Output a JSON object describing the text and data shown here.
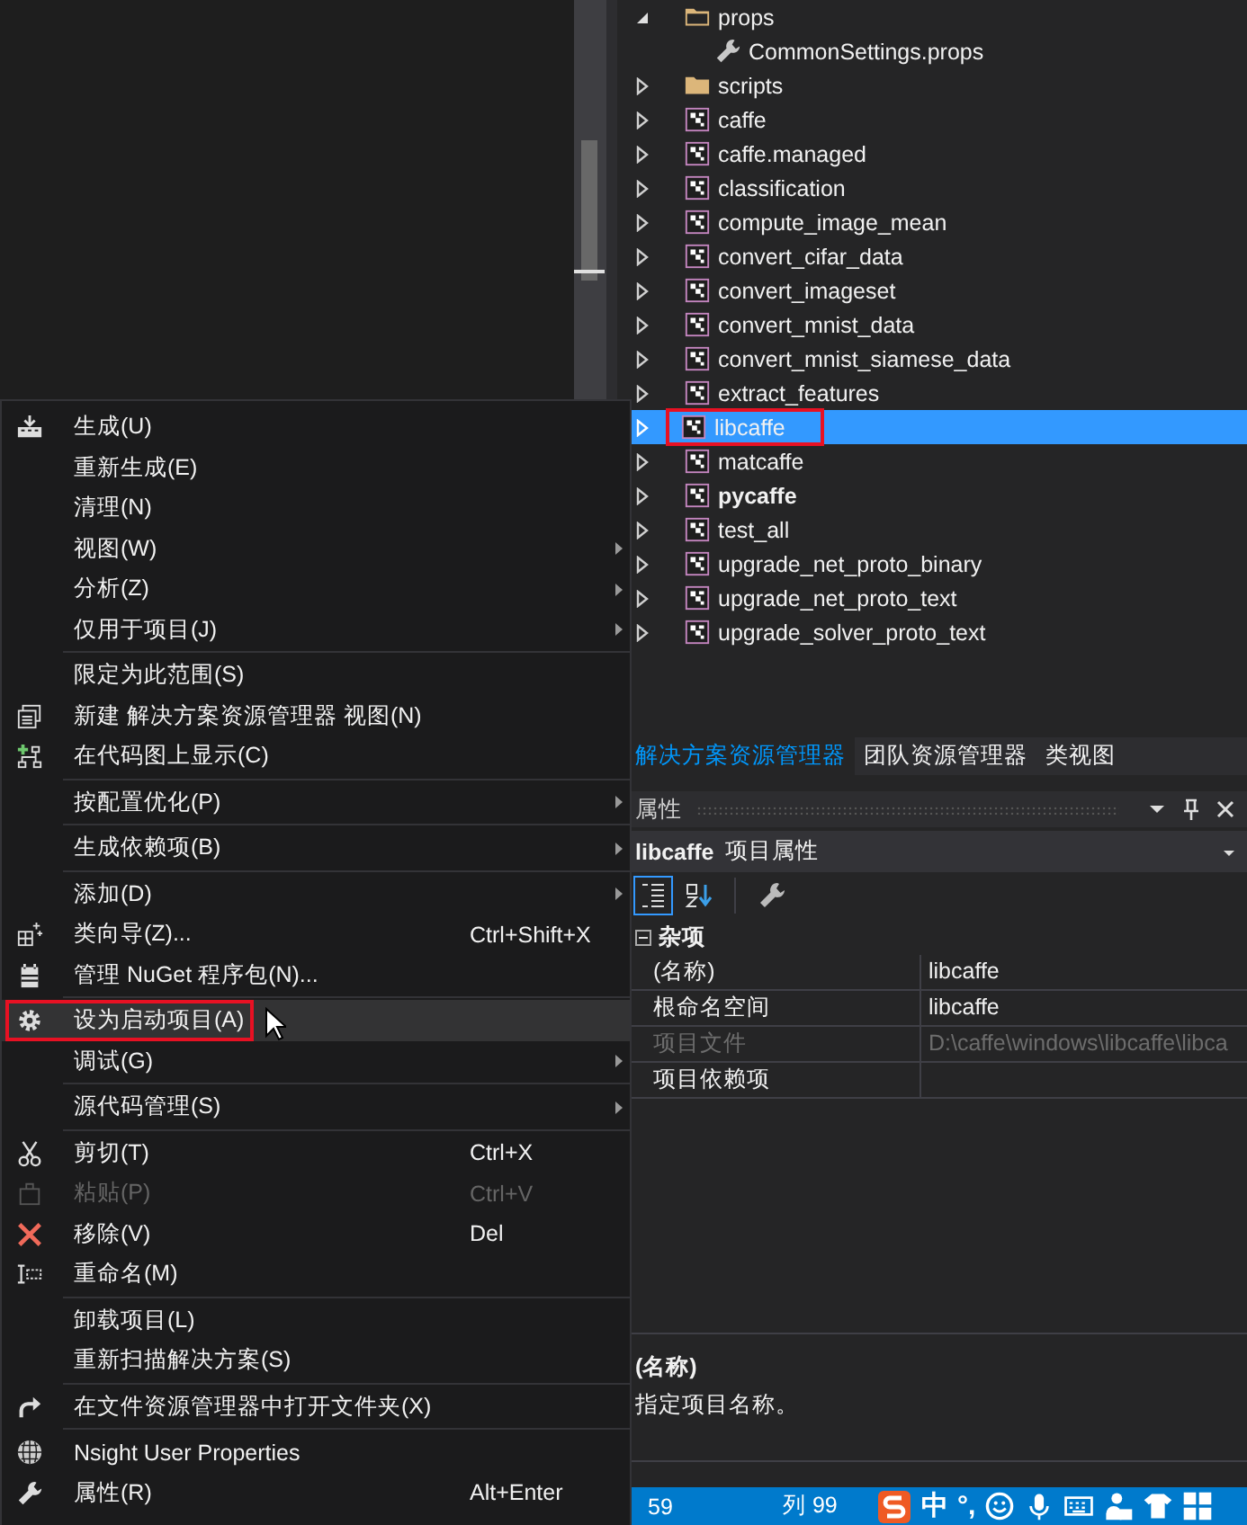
{
  "solution_tree": {
    "items": [
      {
        "label": "props",
        "kind": "folder",
        "expanded": true,
        "bold": false,
        "selected": false,
        "highlighted": false,
        "children": [
          {
            "label": "CommonSettings.props",
            "kind": "settings",
            "bold": false,
            "selected": false,
            "highlighted": false
          }
        ]
      },
      {
        "label": "scripts",
        "kind": "folder",
        "expanded": false,
        "bold": false,
        "selected": false,
        "highlighted": false
      },
      {
        "label": "caffe",
        "kind": "project",
        "expanded": false,
        "bold": false,
        "selected": false,
        "highlighted": false
      },
      {
        "label": "caffe.managed",
        "kind": "project",
        "expanded": false,
        "bold": false,
        "selected": false,
        "highlighted": false
      },
      {
        "label": "classification",
        "kind": "project",
        "expanded": false,
        "bold": false,
        "selected": false,
        "highlighted": false
      },
      {
        "label": "compute_image_mean",
        "kind": "project",
        "expanded": false,
        "bold": false,
        "selected": false,
        "highlighted": false
      },
      {
        "label": "convert_cifar_data",
        "kind": "project",
        "expanded": false,
        "bold": false,
        "selected": false,
        "highlighted": false
      },
      {
        "label": "convert_imageset",
        "kind": "project",
        "expanded": false,
        "bold": false,
        "selected": false,
        "highlighted": false
      },
      {
        "label": "convert_mnist_data",
        "kind": "project",
        "expanded": false,
        "bold": false,
        "selected": false,
        "highlighted": false
      },
      {
        "label": "convert_mnist_siamese_data",
        "kind": "project",
        "expanded": false,
        "bold": false,
        "selected": false,
        "highlighted": false
      },
      {
        "label": "extract_features",
        "kind": "project",
        "expanded": false,
        "bold": false,
        "selected": false,
        "highlighted": false
      },
      {
        "label": "libcaffe",
        "kind": "project",
        "expanded": false,
        "bold": false,
        "selected": true,
        "highlighted": true
      },
      {
        "label": "matcaffe",
        "kind": "project",
        "expanded": false,
        "bold": false,
        "selected": false,
        "highlighted": false
      },
      {
        "label": "pycaffe",
        "kind": "project",
        "expanded": false,
        "bold": true,
        "selected": false,
        "highlighted": false
      },
      {
        "label": "test_all",
        "kind": "project",
        "expanded": false,
        "bold": false,
        "selected": false,
        "highlighted": false
      },
      {
        "label": "upgrade_net_proto_binary",
        "kind": "project",
        "expanded": false,
        "bold": false,
        "selected": false,
        "highlighted": false
      },
      {
        "label": "upgrade_net_proto_text",
        "kind": "project",
        "expanded": false,
        "bold": false,
        "selected": false,
        "highlighted": false
      },
      {
        "label": "upgrade_solver_proto_text",
        "kind": "project",
        "expanded": false,
        "bold": false,
        "selected": false,
        "highlighted": false
      }
    ]
  },
  "tabs": [
    {
      "label": "解决方案资源管理器",
      "selected": true
    },
    {
      "label": "团队资源管理器",
      "selected": false
    },
    {
      "label": "类视图",
      "selected": false
    }
  ],
  "properties": {
    "title": "属性",
    "object_name": "libcaffe",
    "object_type": "项目属性",
    "toolbar": [
      {
        "kind": "categorized",
        "selected": true
      },
      {
        "kind": "alphabetical",
        "selected": false
      },
      {
        "kind": "property-pages",
        "selected": false
      }
    ],
    "category": {
      "label": "杂项",
      "expanded": true
    },
    "rows": [
      {
        "name": "(名称)",
        "value": "libcaffe",
        "disabled": false
      },
      {
        "name": "根命名空间",
        "value": "libcaffe",
        "disabled": false
      },
      {
        "name": "项目文件",
        "value": "D:\\caffe\\windows\\libcaffe\\libca",
        "disabled": true
      },
      {
        "name": "项目依赖项",
        "disabled": false
      }
    ],
    "description": {
      "title": "(名称)",
      "text": "指定项目名称。"
    }
  },
  "menu": {
    "groups": [
      {
        "items": [
          {
            "label": "生成(U)",
            "kind": "build",
            "submenu": false,
            "disabled": false,
            "selected": false,
            "highlighted": false
          },
          {
            "label": "重新生成(E)",
            "kind": "plain",
            "submenu": false,
            "disabled": false,
            "selected": false,
            "highlighted": false
          },
          {
            "label": "清理(N)",
            "kind": "plain",
            "submenu": false,
            "disabled": false,
            "selected": false,
            "highlighted": false
          },
          {
            "label": "视图(W)",
            "kind": "plain",
            "submenu": true,
            "disabled": false,
            "selected": false,
            "highlighted": false
          },
          {
            "label": "分析(Z)",
            "kind": "plain",
            "submenu": true,
            "disabled": false,
            "selected": false,
            "highlighted": false
          },
          {
            "label": "仅用于项目(J)",
            "kind": "plain",
            "submenu": true,
            "disabled": false,
            "selected": false,
            "highlighted": false
          }
        ]
      },
      {
        "items": [
          {
            "label": "限定为此范围(S)",
            "kind": "plain",
            "submenu": false,
            "disabled": false,
            "selected": false,
            "highlighted": false
          },
          {
            "label": "新建 解决方案资源管理器 视图(N)",
            "kind": "new-view",
            "submenu": false,
            "disabled": false,
            "selected": false,
            "highlighted": false
          },
          {
            "label": "在代码图上显示(C)",
            "kind": "code-map",
            "submenu": false,
            "disabled": false,
            "selected": false,
            "highlighted": false
          }
        ]
      },
      {
        "items": [
          {
            "label": "按配置优化(P)",
            "kind": "plain",
            "submenu": true,
            "disabled": false,
            "selected": false,
            "highlighted": false
          }
        ]
      },
      {
        "items": [
          {
            "label": "生成依赖项(B)",
            "kind": "plain",
            "submenu": true,
            "disabled": false,
            "selected": false,
            "highlighted": false
          }
        ]
      },
      {
        "items": [
          {
            "label": "添加(D)",
            "kind": "plain",
            "submenu": true,
            "disabled": false,
            "selected": false,
            "highlighted": false
          },
          {
            "label": "类向导(Z)...",
            "kind": "wizard",
            "shortcut": "Ctrl+Shift+X",
            "submenu": false,
            "disabled": false,
            "selected": false,
            "highlighted": false
          },
          {
            "label": "管理 NuGet 程序包(N)...",
            "kind": "package",
            "submenu": false,
            "disabled": false,
            "selected": false,
            "highlighted": false
          }
        ]
      },
      {
        "items": [
          {
            "label": "设为启动项目(A)",
            "kind": "gear",
            "submenu": false,
            "disabled": false,
            "selected": true,
            "highlighted": true
          },
          {
            "label": "调试(G)",
            "kind": "plain",
            "submenu": true,
            "disabled": false,
            "selected": false,
            "highlighted": false
          }
        ]
      },
      {
        "items": [
          {
            "label": "源代码管理(S)",
            "kind": "plain",
            "submenu": true,
            "disabled": false,
            "selected": false,
            "highlighted": false
          }
        ]
      },
      {
        "items": [
          {
            "label": "剪切(T)",
            "kind": "cut",
            "shortcut": "Ctrl+X",
            "submenu": false,
            "disabled": false,
            "selected": false,
            "highlighted": false
          },
          {
            "label": "粘贴(P)",
            "kind": "paste",
            "shortcut": "Ctrl+V",
            "submenu": false,
            "disabled": true,
            "selected": false,
            "highlighted": false
          },
          {
            "label": "移除(V)",
            "kind": "remove",
            "shortcut": "Del",
            "submenu": false,
            "disabled": false,
            "selected": false,
            "highlighted": false
          },
          {
            "label": "重命名(M)",
            "kind": "rename",
            "submenu": false,
            "disabled": false,
            "selected": false,
            "highlighted": false
          }
        ]
      },
      {
        "items": [
          {
            "label": "卸载项目(L)",
            "kind": "plain",
            "submenu": false,
            "disabled": false,
            "selected": false,
            "highlighted": false
          },
          {
            "label": "重新扫描解决方案(S)",
            "kind": "plain",
            "submenu": false,
            "disabled": false,
            "selected": false,
            "highlighted": false
          }
        ]
      },
      {
        "items": [
          {
            "label": "在文件资源管理器中打开文件夹(X)",
            "kind": "open-folder",
            "submenu": false,
            "disabled": false,
            "selected": false,
            "highlighted": false
          }
        ]
      },
      {
        "items": [
          {
            "label": "Nsight User Properties",
            "kind": "globe",
            "submenu": false,
            "disabled": false,
            "selected": false,
            "highlighted": false
          },
          {
            "label": "属性(R)",
            "kind": "wrench",
            "shortcut": "Alt+Enter",
            "submenu": false,
            "disabled": false,
            "selected": false,
            "highlighted": false
          }
        ]
      }
    ]
  },
  "status_bar": {
    "line": "59",
    "column": "列 99",
    "ime": [
      {
        "kind": "logo"
      },
      {
        "kind": "text",
        "label": "中"
      },
      {
        "kind": "text",
        "label": "°,"
      },
      {
        "kind": "smiley"
      },
      {
        "kind": "mic"
      },
      {
        "kind": "keyboard"
      },
      {
        "kind": "user"
      },
      {
        "kind": "shirt"
      },
      {
        "kind": "grid"
      }
    ]
  }
}
